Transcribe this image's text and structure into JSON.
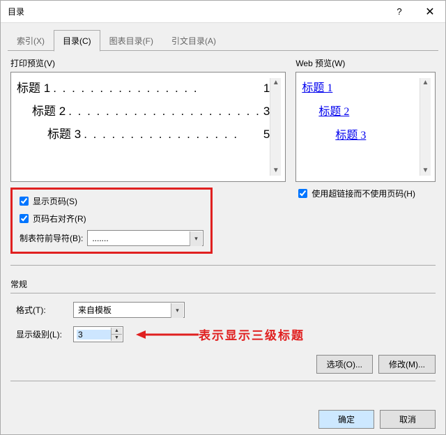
{
  "window": {
    "title": "目录",
    "help": "?",
    "close": "✕"
  },
  "tabs": {
    "index": "索引(X)",
    "toc": "目录(C)",
    "figures": "图表目录(F)",
    "citations": "引文目录(A)"
  },
  "print_preview": {
    "label": "打印预览(V)",
    "lines": [
      {
        "title": "标题  1",
        "dots": ". . . . . . . . . . . . . . . .",
        "page": "1"
      },
      {
        "title": "标题  2",
        "dots": ". . . . . . . . . . . . . . . . . . . . .",
        "page": "3"
      },
      {
        "title": "标题  3",
        "dots": ". . . . . . . . . . . . . . . . .",
        "page": "5"
      }
    ]
  },
  "web_preview": {
    "label": "Web 预览(W)",
    "lines": [
      "标题  1",
      "标题  2",
      "标题  3"
    ]
  },
  "options": {
    "show_pagenum": "显示页码(S)",
    "right_align": "页码右对齐(R)",
    "leader_label": "制表符前导符(B):",
    "leader_value": ".......",
    "hyperlinks": "使用超链接而不使用页码(H)"
  },
  "general": {
    "legend": "常规",
    "format_label": "格式(T):",
    "format_value": "来自模板",
    "levels_label": "显示级别(L):",
    "levels_value": "3"
  },
  "annotation": "表示显示三级标题",
  "buttons": {
    "options": "选项(O)...",
    "modify": "修改(M)...",
    "ok": "确定",
    "cancel": "取消"
  }
}
